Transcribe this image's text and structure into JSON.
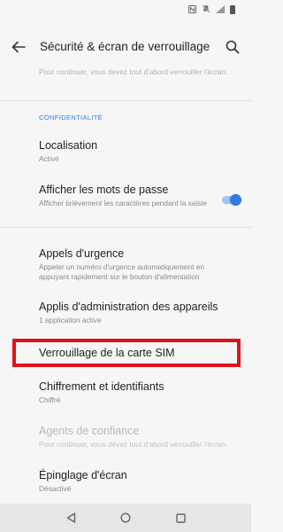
{
  "status_bar": {
    "icons": [
      "nfc-icon",
      "mute-icon",
      "signal-icon",
      "battery-icon"
    ]
  },
  "toolbar": {
    "title": "Sécurité & écran de verrouillage",
    "back_icon": "arrow-left-icon",
    "search_icon": "search-icon"
  },
  "cut_item": {
    "summary": "Pour continuer, vous devez tout d'abord verrouiller l'écran."
  },
  "section": {
    "header": "CONFIDENTIALITÉ"
  },
  "items": [
    {
      "title": "Localisation",
      "summary": "Activé"
    },
    {
      "title": "Afficher les mots de passe",
      "summary": "Afficher brièvement les caractères pendant la saisie"
    },
    {
      "title": "Appels d'urgence",
      "summary": "Appeler un numéro d'urgence automatiquement en appuyant rapidement sur le bouton d'alimentation"
    },
    {
      "title": "Applis d'administration des appareils",
      "summary": "1 application active"
    },
    {
      "title": "Verrouillage de la carte SIM"
    },
    {
      "title": "Chiffrement et identifiants",
      "summary": "Chiffré"
    },
    {
      "title": "Agents de confiance",
      "summary": "Pour continuer, vous devez tout d'abord verrouiller l'écran."
    },
    {
      "title": "Épinglage d'écran",
      "summary": "Désactivé"
    }
  ],
  "toggle": {
    "show_passwords": true
  },
  "colors": {
    "accent": "#2f7be5",
    "highlight": "#e0121b",
    "background": "#f6f6f6"
  },
  "nav_bar": {
    "icons": [
      "back-triangle-icon",
      "home-circle-icon",
      "recents-square-icon"
    ]
  }
}
